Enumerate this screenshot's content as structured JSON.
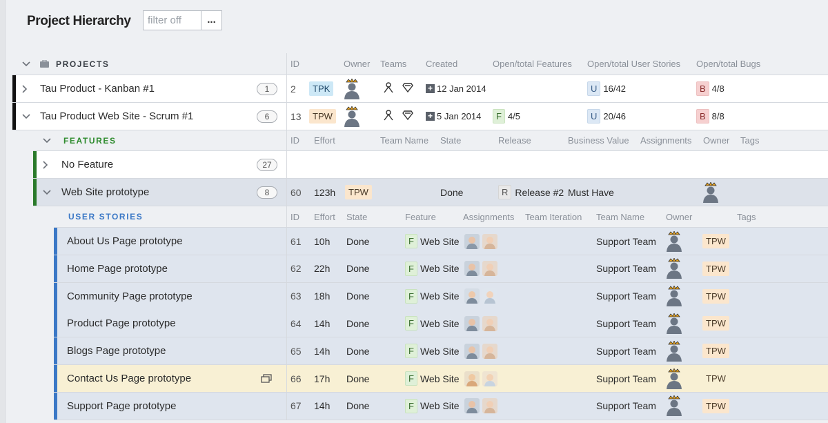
{
  "header": {
    "title": "Project Hierarchy",
    "filter_placeholder": "filter off",
    "more_label": "..."
  },
  "projects_header": {
    "label": "PROJECTS",
    "columns": [
      "ID",
      "Owner",
      "Teams",
      "Created",
      "Open/total Features",
      "Open/total User Stories",
      "Open/total Bugs"
    ]
  },
  "projects": [
    {
      "name": "Tau Product - Kanban #1",
      "count": "1",
      "id": "2",
      "badge": "TPK",
      "created": "12 Jan 2014",
      "features_badge": "",
      "features": "",
      "stories_badge": "U",
      "stories": "16/42",
      "bugs_badge": "B",
      "bugs": "4/8"
    },
    {
      "name": "Tau Product Web Site - Scrum #1",
      "count": "6",
      "id": "13",
      "badge": "TPW",
      "created": "5 Jan 2014",
      "features_badge": "F",
      "features": "4/5",
      "stories_badge": "U",
      "stories": "20/46",
      "bugs_badge": "B",
      "bugs": "8/8"
    }
  ],
  "features_header": {
    "label": "FEATURES",
    "columns": [
      "ID",
      "Effort",
      "Team Name",
      "State",
      "Release",
      "Business Value",
      "Assignments",
      "Owner",
      "Tags"
    ]
  },
  "features": [
    {
      "name": "No Feature",
      "count": "27"
    },
    {
      "name": "Web Site prototype",
      "count": "8",
      "id": "60",
      "effort": "123h",
      "team": "TPW",
      "state": "Done",
      "release_badge": "R",
      "release": "Release #2",
      "business_value": "Must Have"
    }
  ],
  "stories_header": {
    "label": "USER STORIES",
    "columns": [
      "ID",
      "Effort",
      "State",
      "Feature",
      "Assignments",
      "Team Iteration",
      "Team Name",
      "Owner",
      "Tags"
    ]
  },
  "stories": [
    {
      "name": "About Us Page prototype",
      "id": "61",
      "effort": "10h",
      "state": "Done",
      "feature_badge": "F",
      "feature": "Web Site",
      "team": "Support Team",
      "tag": "TPW"
    },
    {
      "name": "Home Page prototype",
      "id": "62",
      "effort": "22h",
      "state": "Done",
      "feature_badge": "F",
      "feature": "Web Site",
      "team": "Support Team",
      "tag": "TPW"
    },
    {
      "name": "Community Page prototype",
      "id": "63",
      "effort": "18h",
      "state": "Done",
      "feature_badge": "F",
      "feature": "Web Site",
      "team": "Support Team",
      "tag": "TPW"
    },
    {
      "name": "Product Page prototype",
      "id": "64",
      "effort": "14h",
      "state": "Done",
      "feature_badge": "F",
      "feature": "Web Site",
      "team": "Support Team",
      "tag": "TPW"
    },
    {
      "name": "Blogs Page prototype",
      "id": "65",
      "effort": "14h",
      "state": "Done",
      "feature_badge": "F",
      "feature": "Web Site",
      "team": "Support Team",
      "tag": "TPW"
    },
    {
      "name": "Contact Us Page prototype",
      "id": "66",
      "effort": "17h",
      "state": "Done",
      "feature_badge": "F",
      "feature": "Web Site",
      "team": "Support Team",
      "tag": "TPW"
    },
    {
      "name": "Support Page prototype",
      "id": "67",
      "effort": "14h",
      "state": "Done",
      "feature_badge": "F",
      "feature": "Web Site",
      "team": "Support Team",
      "tag": "TPW"
    }
  ],
  "icons": {
    "chevron_down": "chevron-down-icon",
    "chevron_right": "chevron-right-icon",
    "briefcase": "briefcase-icon",
    "owner_avatar": "owner-avatar-icon",
    "team_person": "team-person-icon",
    "team_super": "team-super-icon",
    "open_in_popup": "open-popup-icon"
  },
  "colors": {
    "project_marker": "#111111",
    "feature_marker": "#2a7a2a",
    "story_marker": "#3b78c6",
    "highlight_row": "#f8f0d4",
    "story_row": "#dfe5ee",
    "feature_row_selected": "#dde2ea"
  }
}
